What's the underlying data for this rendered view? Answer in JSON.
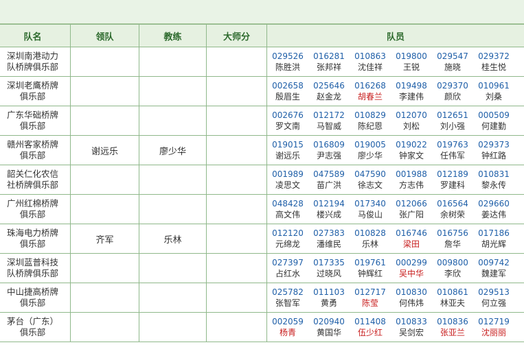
{
  "headers": {
    "team": "队名",
    "leader": "领队",
    "coach": "教练",
    "master": "大师分",
    "members": "队员"
  },
  "colors": {
    "id": "#1f5fa8",
    "highlight": "#c81e1e",
    "header_text": "#2d6a2d",
    "border": "#8fb88a"
  },
  "teams": [
    {
      "name": [
        "深圳南港动力",
        "队桥牌俱乐部"
      ],
      "leader": "",
      "coach": "",
      "master": "",
      "members": [
        {
          "id": "029526",
          "name": "陈胜洪",
          "red": false
        },
        {
          "id": "016281",
          "name": "张邦祥",
          "red": false
        },
        {
          "id": "010863",
          "name": "沈佳祥",
          "red": false
        },
        {
          "id": "019800",
          "name": "王锐",
          "red": false
        },
        {
          "id": "029547",
          "name": "施晓",
          "red": false
        },
        {
          "id": "029372",
          "name": "桂生悦",
          "red": false
        }
      ]
    },
    {
      "name": [
        "深圳老鹰桥牌",
        "俱乐部"
      ],
      "leader": "",
      "coach": "",
      "master": "",
      "members": [
        {
          "id": "002658",
          "name": "殷眉生",
          "red": false
        },
        {
          "id": "025646",
          "name": "赵金龙",
          "red": false
        },
        {
          "id": "016268",
          "name": "胡春兰",
          "red": true
        },
        {
          "id": "019498",
          "name": "李建伟",
          "red": false
        },
        {
          "id": "029370",
          "name": "颜欣",
          "red": false
        },
        {
          "id": "010961",
          "name": "刘桑",
          "red": false
        }
      ]
    },
    {
      "name": [
        "广东华础桥牌",
        "俱乐部"
      ],
      "leader": "",
      "coach": "",
      "master": "",
      "members": [
        {
          "id": "002676",
          "name": "罗文南",
          "red": false
        },
        {
          "id": "012172",
          "name": "马智威",
          "red": false
        },
        {
          "id": "010829",
          "name": "陈纪恩",
          "red": false
        },
        {
          "id": "012070",
          "name": "刘松",
          "red": false
        },
        {
          "id": "012651",
          "name": "刘小强",
          "red": false
        },
        {
          "id": "000509",
          "name": "何建勤",
          "red": false
        }
      ]
    },
    {
      "name": [
        "赣州客家桥牌",
        "俱乐部"
      ],
      "leader": "谢远乐",
      "coach": "廖少华",
      "master": "",
      "members": [
        {
          "id": "019015",
          "name": "谢远乐",
          "red": false
        },
        {
          "id": "016809",
          "name": "尹志强",
          "red": false
        },
        {
          "id": "019005",
          "name": "廖少华",
          "red": false
        },
        {
          "id": "019022",
          "name": "钟家文",
          "red": false
        },
        {
          "id": "019763",
          "name": "任伟军",
          "red": false
        },
        {
          "id": "029373",
          "name": "钟红路",
          "red": false
        }
      ]
    },
    {
      "name": [
        "韶关仁化农信",
        "社桥牌俱乐部"
      ],
      "leader": "",
      "coach": "",
      "master": "",
      "members": [
        {
          "id": "001989",
          "name": "凌思文",
          "red": false
        },
        {
          "id": "047589",
          "name": "苗广洪",
          "red": false
        },
        {
          "id": "047590",
          "name": "徐志文",
          "red": false
        },
        {
          "id": "001988",
          "name": "方志伟",
          "red": false
        },
        {
          "id": "012189",
          "name": "罗建科",
          "red": false
        },
        {
          "id": "010831",
          "name": "黎永传",
          "red": false
        }
      ]
    },
    {
      "name": [
        "广州红棉桥牌",
        "俱乐部"
      ],
      "leader": "",
      "coach": "",
      "master": "",
      "members": [
        {
          "id": "048428",
          "name": "高文伟",
          "red": false
        },
        {
          "id": "012194",
          "name": "楼兴成",
          "red": false
        },
        {
          "id": "017340",
          "name": "马俊山",
          "red": false
        },
        {
          "id": "012066",
          "name": "张广阳",
          "red": false
        },
        {
          "id": "016564",
          "name": "余树荣",
          "red": false
        },
        {
          "id": "029660",
          "name": "姜达伟",
          "red": false
        }
      ]
    },
    {
      "name": [
        "珠海电力桥牌",
        "俱乐部"
      ],
      "leader": "齐军",
      "coach": "乐林",
      "master": "",
      "members": [
        {
          "id": "012120",
          "name": "元绵龙",
          "red": false
        },
        {
          "id": "027383",
          "name": "潘维民",
          "red": false
        },
        {
          "id": "010828",
          "name": "乐林",
          "red": false
        },
        {
          "id": "016746",
          "name": "梁田",
          "red": true
        },
        {
          "id": "016756",
          "name": "詹华",
          "red": false
        },
        {
          "id": "017186",
          "name": "胡光辉",
          "red": false
        }
      ]
    },
    {
      "name": [
        "深圳蓝普科技",
        "队桥牌俱乐部"
      ],
      "leader": "",
      "coach": "",
      "master": "",
      "members": [
        {
          "id": "027397",
          "name": "占红水",
          "red": false
        },
        {
          "id": "017335",
          "name": "过晓风",
          "red": false
        },
        {
          "id": "019761",
          "name": "钟辉红",
          "red": false
        },
        {
          "id": "000299",
          "name": "吴中华",
          "red": true
        },
        {
          "id": "009800",
          "name": "李欣",
          "red": false
        },
        {
          "id": "009742",
          "name": "魏建军",
          "red": false
        }
      ]
    },
    {
      "name": [
        "中山捷高桥牌",
        "俱乐部"
      ],
      "leader": "",
      "coach": "",
      "master": "",
      "members": [
        {
          "id": "025782",
          "name": "张智军",
          "red": false
        },
        {
          "id": "011103",
          "name": "黄勇",
          "red": false
        },
        {
          "id": "012717",
          "name": "陈莹",
          "red": true
        },
        {
          "id": "010830",
          "name": "何伟炜",
          "red": false
        },
        {
          "id": "010861",
          "name": "林亚夫",
          "red": false
        },
        {
          "id": "029513",
          "name": "何立强",
          "red": false
        }
      ]
    },
    {
      "name": [
        "茅台（广东）",
        "俱乐部"
      ],
      "leader": "",
      "coach": "",
      "master": "",
      "members": [
        {
          "id": "002059",
          "name": "杨青",
          "red": true
        },
        {
          "id": "020940",
          "name": "黄国华",
          "red": false
        },
        {
          "id": "011408",
          "name": "伍少红",
          "red": true
        },
        {
          "id": "010833",
          "name": "吴剑宏",
          "red": false
        },
        {
          "id": "010836",
          "name": "张亚兰",
          "red": true
        },
        {
          "id": "012719",
          "name": "沈丽丽",
          "red": true
        }
      ]
    }
  ]
}
